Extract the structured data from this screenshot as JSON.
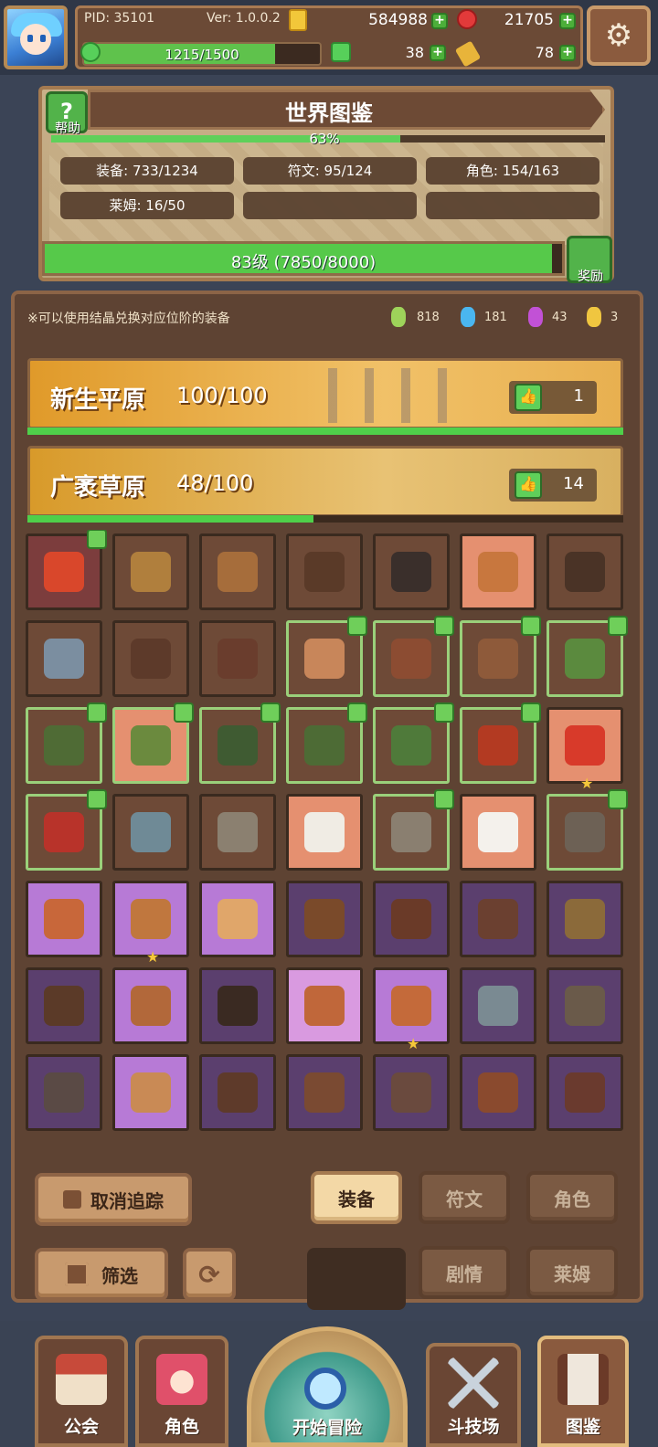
{
  "header": {
    "pid": "PID: 35101",
    "version": "Ver: 1.0.0.2",
    "gold": "584988",
    "gems": "21705",
    "exp_text": "1215/1500",
    "exp_fraction": 0.81,
    "clover_count": "38",
    "key_count": "78",
    "plus_icon": "+"
  },
  "world_catalog": {
    "title": "世界图鉴",
    "help_label": "帮助",
    "help_icon": "?",
    "percent": "63%",
    "percent_fraction": 0.63,
    "categories": [
      "装备: 733/1234",
      "符文: 95/124",
      "角色: 154/163",
      "莱姆: 16/50"
    ],
    "level_text": "83级 (7850/8000)",
    "level_fraction": 0.98,
    "reward_label": "奖励"
  },
  "exchange": {
    "hint": "※可以使用结晶兑换对应位阶的装备",
    "crystals": [
      {
        "color": "#9ed35a",
        "count": "818"
      },
      {
        "color": "#4ab6f0",
        "count": "181"
      },
      {
        "color": "#c251d6",
        "count": "43"
      },
      {
        "color": "#f0c640",
        "count": "3"
      }
    ]
  },
  "regions": [
    {
      "name": "新生平原",
      "count": "100/100",
      "likes": "1",
      "progress": 1.0
    },
    {
      "name": "广袤草原",
      "count": "48/100",
      "likes": "14",
      "progress": 0.48
    }
  ],
  "grid": {
    "rows": [
      [
        {
          "bg": "#7c3d3d",
          "border": "#3a2a1f",
          "art": "#d9472b",
          "like": true,
          "star": false,
          "name": "fire-ring-item"
        },
        {
          "bg": "#6e4a37",
          "border": "#3a2a1f",
          "art": "#b07f3d",
          "like": false,
          "star": false,
          "name": "wrench-item"
        },
        {
          "bg": "#6e4a37",
          "border": "#3a2a1f",
          "art": "#a66d3b",
          "like": false,
          "star": false,
          "name": "bracer-item"
        },
        {
          "bg": "#6e4a37",
          "border": "#3a2a1f",
          "art": "#5a3a28",
          "like": false,
          "star": false,
          "name": "necklace-item"
        },
        {
          "bg": "#6e4a37",
          "border": "#3a2a1f",
          "art": "#3a2f2b",
          "like": false,
          "star": false,
          "name": "staff-item"
        },
        {
          "bg": "#e59070",
          "border": "#3a2a1f",
          "art": "#c8773e",
          "like": false,
          "star": false,
          "name": "dagger-item"
        },
        {
          "bg": "#6e4a37",
          "border": "#3a2a1f",
          "art": "#4a3326",
          "like": false,
          "star": false,
          "name": "helmet-item"
        }
      ],
      [
        {
          "bg": "#6e4a37",
          "border": "#3a2a1f",
          "art": "#7b8ea0",
          "like": false,
          "star": false,
          "name": "sword-item"
        },
        {
          "bg": "#6e4a37",
          "border": "#3a2a1f",
          "art": "#5d3a2a",
          "like": false,
          "star": false,
          "name": "shield-item"
        },
        {
          "bg": "#6e4a37",
          "border": "#3a2a1f",
          "art": "#6a3d2d",
          "like": false,
          "star": false,
          "name": "armor-item"
        },
        {
          "bg": "#6e4a37",
          "border": "#9ad07a",
          "art": "#c8865a",
          "like": true,
          "star": false,
          "name": "boot-item"
        },
        {
          "bg": "#6e4a37",
          "border": "#9ad07a",
          "art": "#8c4c32",
          "like": true,
          "star": false,
          "name": "belt-item"
        },
        {
          "bg": "#6e4a37",
          "border": "#9ad07a",
          "art": "#8e5a3a",
          "like": true,
          "star": false,
          "name": "gloves-item"
        },
        {
          "bg": "#6e4a37",
          "border": "#9ad07a",
          "art": "#5b8a3e",
          "like": true,
          "star": false,
          "name": "green-sword-item"
        }
      ],
      [
        {
          "bg": "#6e4a37",
          "border": "#9ad07a",
          "art": "#4f6b35",
          "like": true,
          "star": false,
          "name": "green-gloves-item"
        },
        {
          "bg": "#e59070",
          "border": "#9ad07a",
          "art": "#6b8a3e",
          "like": true,
          "star": false,
          "name": "green-belt-item"
        },
        {
          "bg": "#6e4a37",
          "border": "#9ad07a",
          "art": "#3f5b32",
          "like": true,
          "star": false,
          "name": "green-helmet-item"
        },
        {
          "bg": "#6e4a37",
          "border": "#9ad07a",
          "art": "#4d6b35",
          "like": true,
          "star": false,
          "name": "green-armor-item"
        },
        {
          "bg": "#6e4a37",
          "border": "#9ad07a",
          "art": "#4f7a3a",
          "like": true,
          "star": false,
          "name": "green-necklace-item"
        },
        {
          "bg": "#6e4a37",
          "border": "#9ad07a",
          "art": "#b33a22",
          "like": true,
          "star": false,
          "name": "red-armor-item"
        },
        {
          "bg": "#e59070",
          "border": "#3a2a1f",
          "art": "#d83a2a",
          "like": false,
          "star": true,
          "name": "fire-necklace-item"
        }
      ],
      [
        {
          "bg": "#6e4a37",
          "border": "#9ad07a",
          "art": "#b8332a",
          "like": true,
          "star": false,
          "name": "red-boots-item"
        },
        {
          "bg": "#6e4a37",
          "border": "#3a2a1f",
          "art": "#6f8a96",
          "like": false,
          "star": false,
          "name": "blue-dagger-item"
        },
        {
          "bg": "#6e4a37",
          "border": "#3a2a1f",
          "art": "#8b8070",
          "like": false,
          "star": false,
          "name": "bone-armor-item"
        },
        {
          "bg": "#e59070",
          "border": "#3a2a1f",
          "art": "#f0ece4",
          "like": false,
          "star": false,
          "name": "white-boots-item"
        },
        {
          "bg": "#6e4a37",
          "border": "#9ad07a",
          "art": "#8a7f70",
          "like": true,
          "star": false,
          "name": "stone-bracer-item"
        },
        {
          "bg": "#e59070",
          "border": "#3a2a1f",
          "art": "#f4f1ec",
          "like": false,
          "star": false,
          "name": "shell-item"
        },
        {
          "bg": "#6e4a37",
          "border": "#9ad07a",
          "art": "#6d6155",
          "like": true,
          "star": false,
          "name": "fur-collar-item"
        }
      ],
      [
        {
          "bg": "#b77ad6",
          "border": "#3a2a1f",
          "art": "#c8673a",
          "like": false,
          "star": false,
          "name": "beast-helm-item"
        },
        {
          "bg": "#b77ad6",
          "border": "#3a2a1f",
          "art": "#c0773e",
          "like": false,
          "star": true,
          "name": "orange-necklace-item"
        },
        {
          "bg": "#b77ad6",
          "border": "#3a2a1f",
          "art": "#e0a66a",
          "like": false,
          "star": false,
          "name": "orange-glove-item"
        },
        {
          "bg": "#5b3f6e",
          "border": "#3a2a1f",
          "art": "#7a4a2a",
          "like": false,
          "star": false,
          "name": "bow-item"
        },
        {
          "bg": "#5b3f6e",
          "border": "#3a2a1f",
          "art": "#6a3a28",
          "like": false,
          "star": false,
          "name": "leather-armor-item"
        },
        {
          "bg": "#5b3f6e",
          "border": "#3a2a1f",
          "art": "#6b4030",
          "like": false,
          "star": false,
          "name": "leather-belt-item"
        },
        {
          "bg": "#5b3f6e",
          "border": "#3a2a1f",
          "art": "#8b6a3a",
          "like": false,
          "star": false,
          "name": "horn-item"
        }
      ],
      [
        {
          "bg": "#5b3f6e",
          "border": "#3a2a1f",
          "art": "#5b3a28",
          "like": false,
          "star": false,
          "name": "hood-item"
        },
        {
          "bg": "#b77ad6",
          "border": "#3a2a1f",
          "art": "#b2683a",
          "like": false,
          "star": false,
          "name": "tiger-collar-item"
        },
        {
          "bg": "#5b3f6e",
          "border": "#3a2a1f",
          "art": "#3a2a22",
          "like": false,
          "star": false,
          "name": "amulet-item"
        },
        {
          "bg": "#d99ae0",
          "border": "#3a2a1f",
          "art": "#c0673a",
          "like": false,
          "star": false,
          "name": "pink-helmet-item"
        },
        {
          "bg": "#b77ad6",
          "border": "#3a2a1f",
          "art": "#c46a3a",
          "like": false,
          "star": true,
          "name": "shield-gem-item"
        },
        {
          "bg": "#5b3f6e",
          "border": "#3a2a1f",
          "art": "#7a8a92",
          "like": false,
          "star": false,
          "name": "crossbow-item"
        },
        {
          "bg": "#5b3f6e",
          "border": "#3a2a1f",
          "art": "#6a5a4a",
          "like": false,
          "star": false,
          "name": "spear-item"
        }
      ],
      [
        {
          "bg": "#5b3f6e",
          "border": "#3a2a1f",
          "art": "#5a4a45",
          "like": false,
          "star": false,
          "name": "wolf-helm-item"
        },
        {
          "bg": "#b77ad6",
          "border": "#3a2a1f",
          "art": "#c98a55",
          "like": false,
          "star": false,
          "name": "bone-collar-item"
        },
        {
          "bg": "#5b3f6e",
          "border": "#3a2a1f",
          "art": "#5e3a2a",
          "like": false,
          "star": false,
          "name": "dark-ring-item"
        },
        {
          "bg": "#5b3f6e",
          "border": "#3a2a1f",
          "art": "#7a4a32",
          "like": false,
          "star": false,
          "name": "war-helm-item"
        },
        {
          "bg": "#5b3f6e",
          "border": "#3a2a1f",
          "art": "#6a4a3e",
          "like": false,
          "star": false,
          "name": "axe-item"
        },
        {
          "bg": "#5b3f6e",
          "border": "#3a2a1f",
          "art": "#8a4a2e",
          "like": false,
          "star": false,
          "name": "horn-helm-item"
        },
        {
          "bg": "#5b3f6e",
          "border": "#3a2a1f",
          "art": "#6a3a2e",
          "like": false,
          "star": false,
          "name": "boar-helm-item"
        }
      ]
    ]
  },
  "controls": {
    "untrack_label": "取消追踪",
    "filter_label": "筛选",
    "refresh_icon": "⟳",
    "tabs": [
      "装备",
      "符文",
      "角色",
      "剧情",
      "莱姆"
    ],
    "active_tab": "装备"
  },
  "nav": {
    "items": [
      "公会",
      "角色",
      "开始冒险",
      "斗技场",
      "图鉴"
    ]
  },
  "icons": {
    "settings": "⚙",
    "thumbs_up": "👍",
    "star": "★",
    "search": "⌕"
  }
}
